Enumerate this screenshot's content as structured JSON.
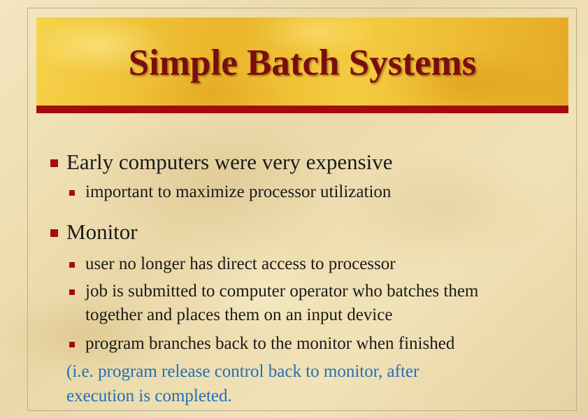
{
  "slide": {
    "title": "Simple Batch Systems",
    "bullets": [
      {
        "text": "Early computers were very expensive",
        "sub": [
          {
            "lines": [
              "important to maximize processor utilization"
            ]
          }
        ]
      },
      {
        "text": "Monitor",
        "sub": [
          {
            "lines": [
              "user no longer has direct access to processor"
            ]
          },
          {
            "lines": [
              "job is submitted to computer operator who batches them",
              "together and places them on an input device"
            ]
          },
          {
            "lines": [
              "program branches back to the monitor when finished"
            ]
          }
        ]
      }
    ],
    "note_lines": [
      "(i.e. program release control back to monitor, after",
      "execution is completed."
    ]
  },
  "colors": {
    "title_text": "#7a0e0e",
    "title_band": "#f1c232",
    "accent_bar": "#a40c0c",
    "bullet": "#a40c0c",
    "body_text": "#1a1a1a",
    "note_text": "#1f6fb5"
  }
}
